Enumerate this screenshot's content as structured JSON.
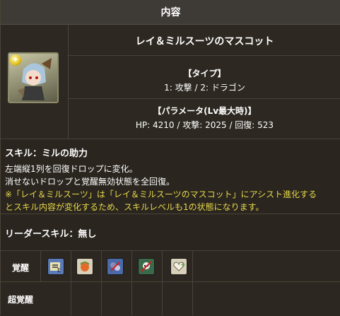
{
  "header": {
    "title": "内容"
  },
  "card": {
    "name": "レイ＆ミルスーツのマスコット",
    "type_heading": "【タイプ】",
    "type_value": "1: 攻撃 / 2: ドラゴン",
    "params_heading": "【パラメータ(Lv最大時)】",
    "params_value": "HP: 4210 / 攻撃: 2025 / 回復: 523",
    "attribute_icon": "light-attribute-icon"
  },
  "skill": {
    "title": "スキル：ミルの助力",
    "line1": "左端縦1列を回復ドロップに変化。",
    "line2": "消せないドロップと覚醒無効状態を全回復。",
    "note_line1": "※「レイ＆ミルスーツ」は「レイ＆ミルスーツのマスコット」にアシスト進化する",
    "note_line2": "とスキル内容が変化するため、スキルレベルも1の状態になります。"
  },
  "leader": {
    "title": "リーダースキル：無し"
  },
  "awakening": {
    "label": "覚醒",
    "icons": [
      "skill-boost-icon",
      "bind-resist-icon",
      "jammer-resist-icon",
      "poison-resist-icon",
      "heart-plus-icon"
    ]
  },
  "super_awakening": {
    "label": "超覚醒"
  },
  "colors": {
    "background": "#2b2620",
    "note_yellow": "#e8d84a",
    "border": "#4a4337"
  }
}
